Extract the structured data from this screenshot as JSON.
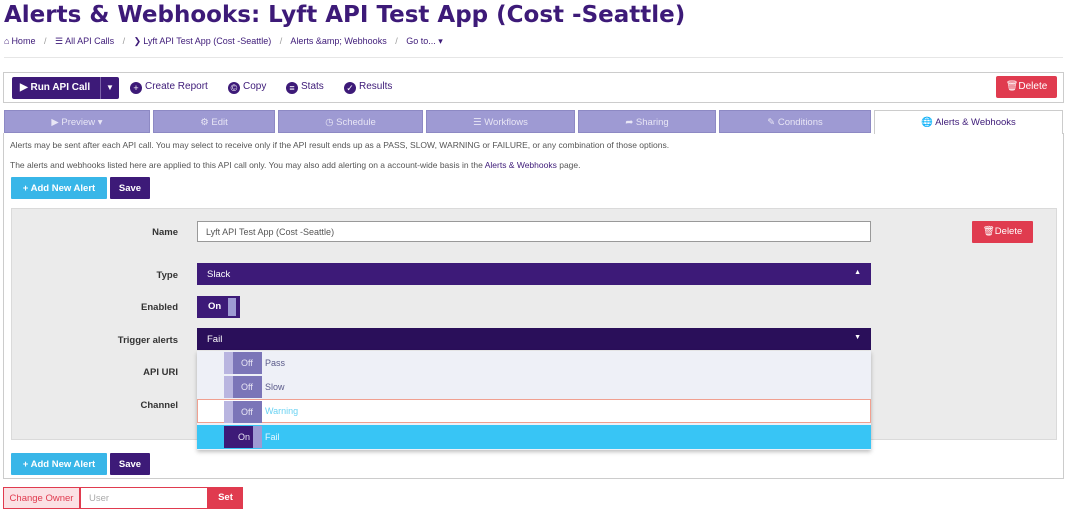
{
  "page": {
    "title": "Alerts & Webhooks: Lyft API Test App (Cost -Seattle)"
  },
  "breadcrumb": {
    "home": "Home",
    "all_api_calls": "All API Calls",
    "app": "Lyft API Test App (Cost -Seattle)",
    "current": "Alerts &amp; Webhooks",
    "goto": "Go to... ▾"
  },
  "toolbar": {
    "run": "Run API Call",
    "create_report": "Create Report",
    "copy": "Copy",
    "stats": "Stats",
    "results": "Results",
    "delete": "Delete"
  },
  "tabs": [
    {
      "label": "Preview ▾",
      "icon": "play-icon"
    },
    {
      "label": "Edit",
      "icon": "gear-icon"
    },
    {
      "label": "Schedule",
      "icon": "clock-icon"
    },
    {
      "label": "Workflows",
      "icon": "list-icon"
    },
    {
      "label": "Sharing",
      "icon": "share-icon"
    },
    {
      "label": "Conditions",
      "icon": "pencil-icon"
    },
    {
      "label": "Alerts & Webhooks",
      "icon": "globe-icon",
      "active": true
    }
  ],
  "info": {
    "line1": "Alerts may be sent after each API call. You may select to receive only if the API result ends up as a PASS, SLOW, WARNING or FAILURE, or any combination of those options.",
    "line2_pre": "The alerts and webhooks listed here are applied to this API call only. You may also add alerting on a account-wide basis in the ",
    "line2_link": "Alerts & Webhooks",
    "line2_post": " page."
  },
  "buttons": {
    "add_new_alert": "Add New Alert",
    "save": "Save"
  },
  "alert": {
    "name_label": "Name",
    "name_value": "Lyft API Test App (Cost -Seattle)",
    "delete": "Delete",
    "type_label": "Type",
    "type_value": "Slack",
    "enabled_label": "Enabled",
    "enabled_value": "On",
    "trigger_label": "Trigger alerts",
    "trigger_value": "Fail",
    "api_uri_label": "API URI",
    "channel_label": "Channel",
    "trigger_options": [
      {
        "state": "Off",
        "label": "Pass"
      },
      {
        "state": "Off",
        "label": "Slow"
      },
      {
        "state": "Off",
        "label": "Warning"
      },
      {
        "state": "On",
        "label": "Fail"
      }
    ]
  },
  "owner": {
    "change_owner": "Change Owner",
    "user_placeholder": "User",
    "set": "Set"
  },
  "colors": {
    "brand": "#3d1a78",
    "danger": "#e03b4f",
    "info": "#38b6e8",
    "tab": "#9e9ad3"
  }
}
